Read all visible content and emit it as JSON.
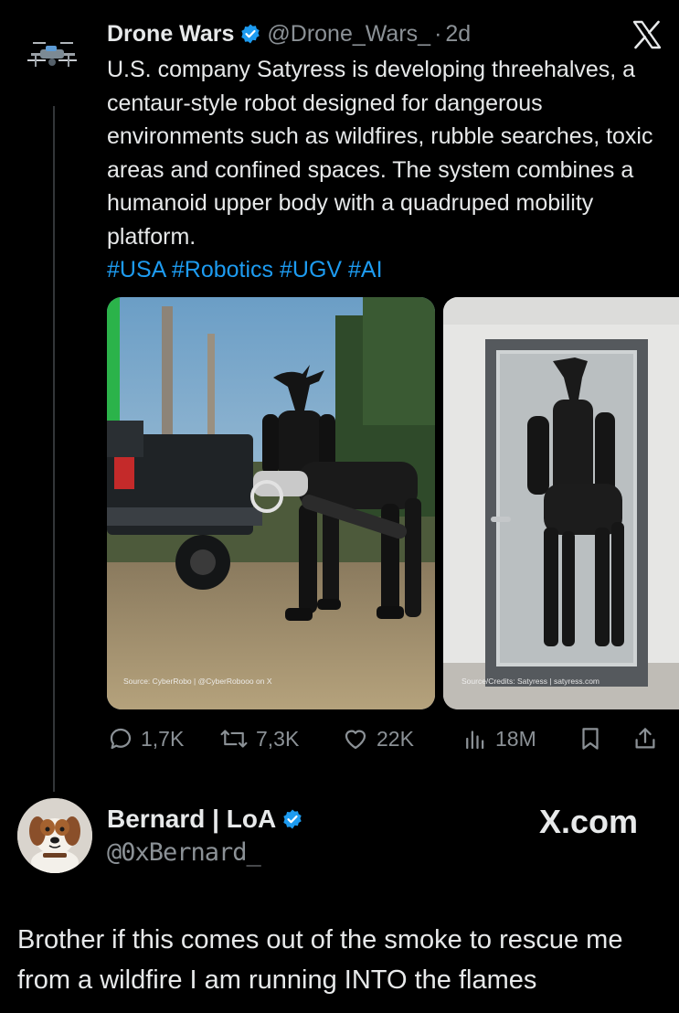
{
  "tweet": {
    "author_name": "Drone Wars",
    "handle": "@Drone_Wars_",
    "separator": "·",
    "time": "2d",
    "text": "U.S. company Satyress is developing threehalves, a centaur-style robot designed for dangerous environments such as wildfires, rubble searches, toxic areas and confined spaces. The system combines a humanoid upper body with a quadruped mobility platform.",
    "hashtags": "#USA #Robotics #UGV #AI",
    "media": [
      {
        "caption": "Source: CyberRobo | @CyberRobooo on X"
      },
      {
        "caption": "Source/Credits: Satyress | satyress.com"
      }
    ],
    "actions": {
      "replies": "1,7K",
      "reposts": "7,3K",
      "likes": "22K",
      "views": "18M"
    }
  },
  "reply": {
    "author_name": "Bernard | LoA",
    "handle": "@0xBernard_",
    "watermark": "X.com",
    "text": "Brother if this comes out of the smoke to rescue me from a wildfire I am running INTO the flames"
  },
  "colors": {
    "background": "#000000",
    "text": "#e7e9ea",
    "muted": "#8b9196",
    "link": "#1d9bf0",
    "verified": "#1d9bf0"
  }
}
